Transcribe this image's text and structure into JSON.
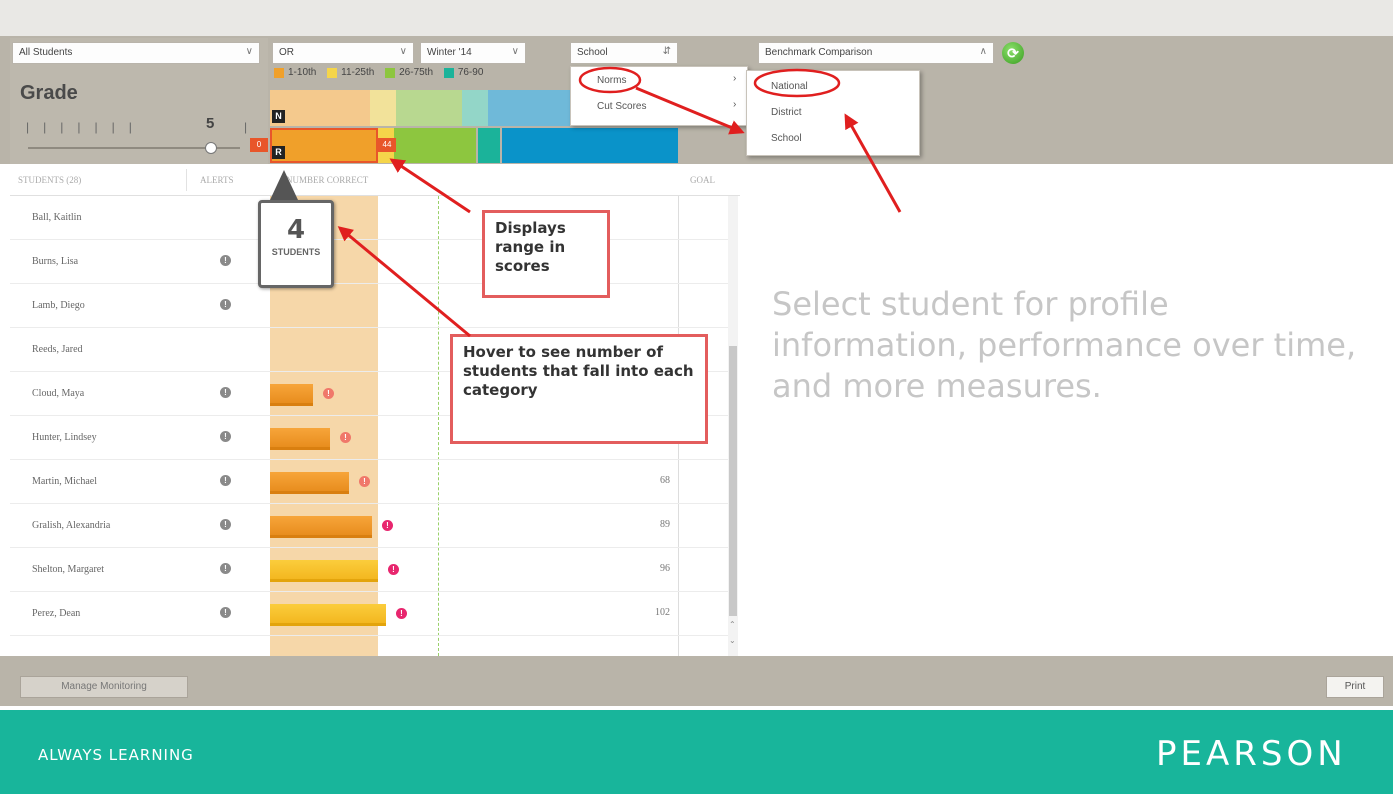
{
  "filters": {
    "students": "All Students",
    "subject": "OR",
    "term": "Winter '14",
    "level": "School",
    "benchmark": "Benchmark Comparison"
  },
  "legend": [
    {
      "label": "1-10th",
      "color": "#f0a02a"
    },
    {
      "label": "11-25th",
      "color": "#f5d54a"
    },
    {
      "label": "26-75th",
      "color": "#8dc63f"
    },
    {
      "label": "76-90",
      "color": "#1bb39a"
    }
  ],
  "grade": {
    "label": "Grade",
    "value": "5"
  },
  "range": {
    "min_marker": "0",
    "max_marker": "44",
    "top_badge": "N",
    "bottom_badge": "R"
  },
  "columns": {
    "students": "STUDENTS (28)",
    "alerts": "ALERTS",
    "correct": "NUMBER CORRECT",
    "goal": "GOAL"
  },
  "tooltip": {
    "count": "4",
    "label": "STUDENTS"
  },
  "norms_menu": {
    "items": [
      "Norms",
      "Cut Scores"
    ]
  },
  "scope_menu": {
    "items": [
      "National",
      "District",
      "School"
    ]
  },
  "callouts": {
    "range": "Displays range in scores",
    "hover": "Hover to see number of students that fall into each category"
  },
  "students": [
    {
      "name": "Ball, Kaitlin",
      "alert": false,
      "bar": 0,
      "bar_color": "orange",
      "warn": false,
      "warn_color": "",
      "goal": ""
    },
    {
      "name": "Burns, Lisa",
      "alert": true,
      "bar": 0,
      "bar_color": "orange",
      "warn": false,
      "warn_color": "",
      "goal": ""
    },
    {
      "name": "Lamb, Diego",
      "alert": true,
      "bar": 0,
      "bar_color": "orange",
      "warn": false,
      "warn_color": "",
      "goal": ""
    },
    {
      "name": "Reeds, Jared",
      "alert": false,
      "bar": 0,
      "bar_color": "orange",
      "warn": false,
      "warn_color": "",
      "goal": ""
    },
    {
      "name": "Cloud, Maya",
      "alert": true,
      "bar": 0.4,
      "bar_color": "orange",
      "warn": true,
      "warn_color": "#f0786a",
      "goal": ""
    },
    {
      "name": "Hunter, Lindsey",
      "alert": true,
      "bar": 0.56,
      "bar_color": "orange",
      "warn": true,
      "warn_color": "#f0786a",
      "goal": ""
    },
    {
      "name": "Martin, Michael",
      "alert": true,
      "bar": 0.73,
      "bar_color": "orange",
      "warn": true,
      "warn_color": "#f0786a",
      "goal": "68"
    },
    {
      "name": "Gralish, Alexandria",
      "alert": true,
      "bar": 0.94,
      "bar_color": "orange",
      "warn": true,
      "warn_color": "#e8266e",
      "goal": "89"
    },
    {
      "name": "Shelton, Margaret",
      "alert": true,
      "bar": 1.0,
      "bar_color": "yellow",
      "warn": true,
      "warn_color": "#e8266e",
      "goal": "96"
    },
    {
      "name": "Perez, Dean",
      "alert": true,
      "bar": 1.07,
      "bar_color": "yellow",
      "warn": true,
      "warn_color": "#e8266e",
      "goal": "102"
    }
  ],
  "profile_prompt": "Select student for profile information, performance over time, and more measures.",
  "buttons": {
    "manage": "Manage Monitoring",
    "print": "Print"
  },
  "footer": {
    "left": "ALWAYS LEARNING",
    "right": "PEARSON"
  },
  "colors": {
    "toolbar": "#b9b4a9",
    "footer": "#18b59b"
  }
}
